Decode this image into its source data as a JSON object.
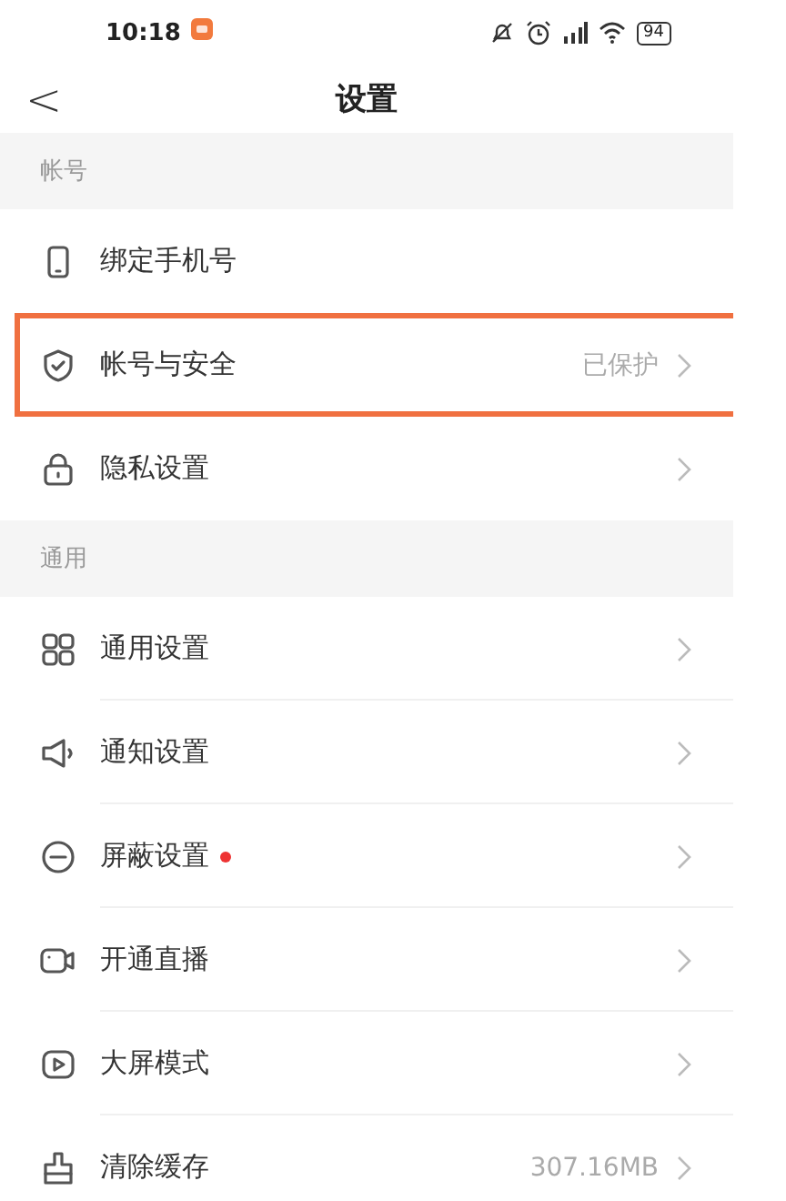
{
  "status_bar": {
    "time": "10:18",
    "battery": "94"
  },
  "nav": {
    "back": "<",
    "title": "设置"
  },
  "sections": [
    {
      "header": "帐号",
      "rows": [
        {
          "label": "绑定手机号",
          "chevron": false,
          "dot": false,
          "highlighted": false
        },
        {
          "label": "帐号与安全",
          "value": "已保护",
          "chevron": true,
          "dot": false,
          "highlighted": true
        },
        {
          "label": "隐私设置",
          "chevron": true,
          "dot": false,
          "highlighted": false
        }
      ]
    },
    {
      "header": "通用",
      "rows": [
        {
          "label": "通用设置",
          "chevron": true,
          "dot": false,
          "highlighted": false
        },
        {
          "label": "通知设置",
          "chevron": true,
          "dot": false,
          "highlighted": false
        },
        {
          "label": "屏蔽设置",
          "chevron": true,
          "dot": true,
          "highlighted": false
        },
        {
          "label": "开通直播",
          "chevron": true,
          "dot": false,
          "highlighted": false
        },
        {
          "label": "大屏模式",
          "chevron": true,
          "dot": false,
          "highlighted": false
        },
        {
          "label": "清除缓存",
          "value": "307.16MB",
          "chevron": true,
          "dot": false,
          "highlighted": false
        }
      ]
    }
  ]
}
